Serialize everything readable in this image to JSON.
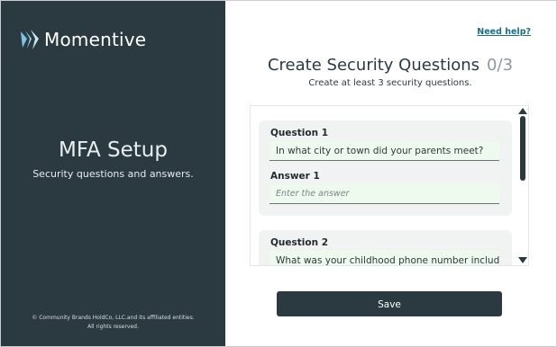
{
  "brand": {
    "name": "Momentive",
    "logo_icon": "momentive-logo-icon"
  },
  "left_panel": {
    "title": "MFA Setup",
    "subtitle": "Security questions and answers.",
    "copyright_line1": "© Community Brands HoldCo, LLC.and its affiliated entities.",
    "copyright_line2": "All rights reserved."
  },
  "header": {
    "help_link": "Need help?",
    "title": "Create Security Questions",
    "count": "0/3",
    "subtitle": "Create at least 3 security questions."
  },
  "questions": [
    {
      "question_label": "Question 1",
      "question_value": "In what city or town did your parents meet?",
      "answer_label": "Answer 1",
      "answer_placeholder": "Enter the answer",
      "answer_value": ""
    },
    {
      "question_label": "Question 2",
      "question_value": "What was your childhood phone number including"
    }
  ],
  "actions": {
    "save_label": "Save"
  },
  "colors": {
    "panel": "#2b3a40",
    "field_bg": "#effaee",
    "link": "#1a6f86"
  }
}
